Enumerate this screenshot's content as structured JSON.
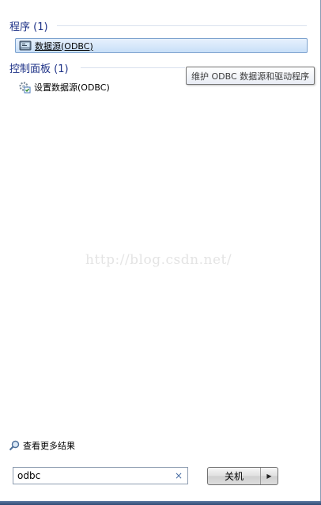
{
  "sections": {
    "programs": {
      "header": "程序 (1)"
    },
    "control_panel": {
      "header": "控制面板 (1)"
    }
  },
  "results": {
    "odbc_program": {
      "label": "数据源(ODBC)",
      "icon": "database-icon"
    },
    "odbc_settings": {
      "label": "设置数据源(ODBC)",
      "icon": "settings-gear-icon"
    }
  },
  "tooltip": {
    "text": "维护 ODBC 数据源和驱动程序"
  },
  "watermark": {
    "text": "http://blog.csdn.net/"
  },
  "see_more": {
    "label": "查看更多结果",
    "icon": "search-icon"
  },
  "search": {
    "value": "odbc",
    "clear_icon": "clear-icon",
    "clear_glyph": "×"
  },
  "shutdown": {
    "label": "关机",
    "arrow_glyph": "▶"
  },
  "colors": {
    "header_text": "#1e3287",
    "selection_border": "#7da2ce",
    "selection_fill": "#c8dff8"
  }
}
